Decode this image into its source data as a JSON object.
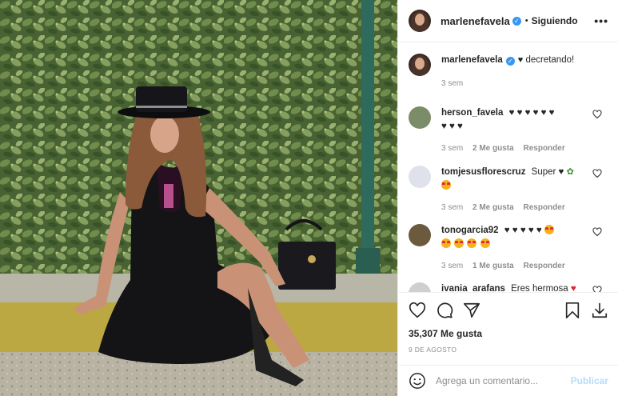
{
  "post": {
    "photo_alt": "",
    "header": {
      "username": "marlenefavela",
      "dot": "•",
      "follow_status": "Siguiendo",
      "more_label": "•••"
    },
    "caption": {
      "username": "marlenefavela",
      "text": "decretando!",
      "time": "3 sem"
    },
    "comments": [
      {
        "username": "herson_favela",
        "text": "",
        "emojis": [
          "black-heart",
          "black-heart",
          "black-heart",
          "black-heart",
          "black-heart",
          "black-heart",
          "black-heart",
          "black-heart",
          "black-heart"
        ],
        "time": "3 sem",
        "likes": "2 Me gusta",
        "reply": "Responder"
      },
      {
        "username": "tomjesusflorescruz",
        "text": "Super",
        "time": "3 sem",
        "likes": "2 Me gusta",
        "reply": "Responder"
      },
      {
        "username": "tonogarcia92",
        "text": "",
        "time": "3 sem",
        "likes": "1 Me gusta",
        "reply": "Responder"
      },
      {
        "username": "ivania_arafans",
        "text": "Eres hermosa",
        "time": "",
        "likes": "",
        "reply": ""
      }
    ],
    "likes_count": "35,307 Me gusta",
    "date": "9 DE AGOSTO",
    "comment_placeholder": "Agrega un comentario...",
    "publish_label": "Publicar",
    "colors": {
      "accent": "#3897f0",
      "publish_disabled": "#b2dffc",
      "muted": "#8e8e8e",
      "text": "#262626"
    }
  }
}
